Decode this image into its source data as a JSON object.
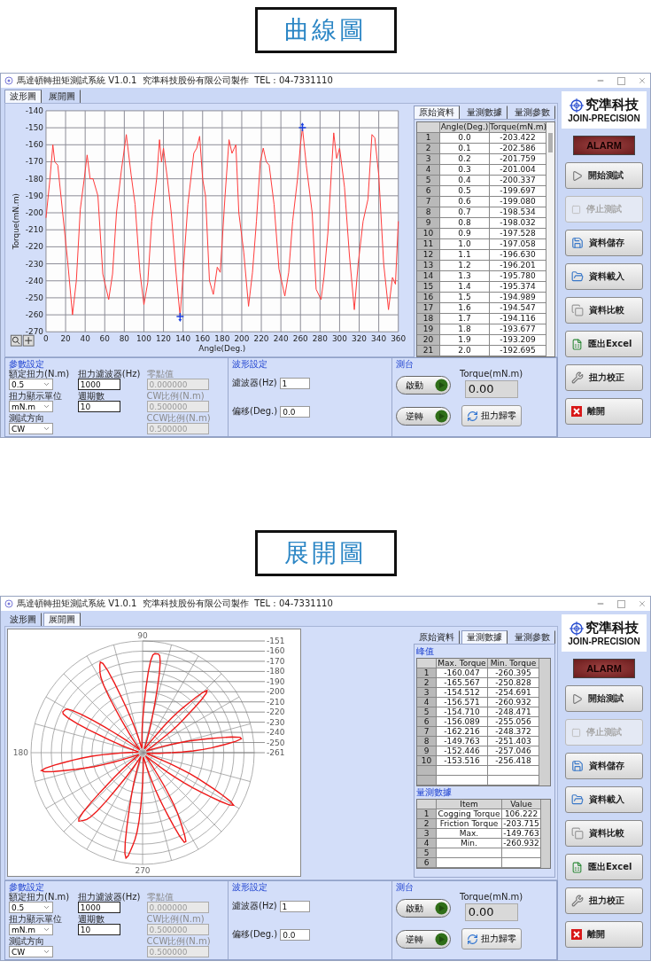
{
  "sections": [
    {
      "heading": "曲線圖",
      "window": {
        "title": "馬達頓轉扭矩測試系統 V1.0.1  究準科技股份有限公司製作  TEL : 04-7331110",
        "view_tabs": [
          {
            "label": "波形圖",
            "selected": true
          },
          {
            "label": "展開圖",
            "selected": false
          }
        ],
        "view": {
          "kind": "line",
          "chart_data": {
            "type": "line",
            "xlabel": "Angle(Deg.)",
            "ylabel": "Torque(mN.m)",
            "xlim": [
              0,
              360
            ],
            "ylim": [
              -270,
              -140
            ],
            "xticks": [
              0,
              20,
              40,
              60,
              80,
              100,
              120,
              140,
              160,
              180,
              200,
              220,
              240,
              260,
              280,
              300,
              320,
              340,
              360
            ],
            "yticks": [
              -140,
              -150,
              -160,
              -170,
              -180,
              -190,
              -200,
              -210,
              -220,
              -230,
              -240,
              -250,
              -260,
              -270
            ],
            "x": [
              0,
              4,
              7,
              9,
              12,
              17,
              22,
              27,
              31,
              35,
              39,
              42,
              45,
              48,
              53,
              58,
              64,
              68,
              72,
              77,
              82,
              87,
              91,
              96,
              100,
              104,
              108,
              113,
              116,
              118,
              120,
              124,
              128,
              133,
              137,
              141,
              145,
              151,
              154,
              157,
              160,
              163,
              167,
              171,
              175,
              178,
              183,
              187,
              190,
              194,
              197,
              202,
              207,
              211,
              215,
              219,
              222,
              225,
              228,
              233,
              238,
              244,
              248,
              252,
              257,
              260,
              262,
              266,
              272,
              276,
              281,
              284,
              288,
              292,
              294,
              297,
              300,
              305,
              310,
              315,
              319,
              324,
              329,
              333,
              336,
              340,
              345,
              350,
              354,
              357,
              360
            ],
            "values": [
              -203,
              -180,
              -160,
              -170,
              -172,
              -200,
              -228,
              -260,
              -240,
              -198,
              -180,
              -166,
              -180,
              -180,
              -190,
              -236,
              -251,
              -236,
              -200,
              -175,
              -154,
              -178,
              -195,
              -235,
              -254,
              -241,
              -205,
              -180,
              -157,
              -170,
              -162,
              -180,
              -200,
              -236,
              -261,
              -228,
              -195,
              -165,
              -162,
              -155,
              -180,
              -190,
              -240,
              -248,
              -232,
              -235,
              -190,
              -157,
              -165,
              -160,
              -200,
              -223,
              -255,
              -235,
              -205,
              -170,
              -162,
              -170,
              -172,
              -195,
              -233,
              -249,
              -235,
              -205,
              -180,
              -160,
              -150,
              -172,
              -200,
              -245,
              -251,
              -238,
              -212,
              -172,
              -153,
              -168,
              -162,
              -185,
              -225,
              -257,
              -230,
              -205,
              -192,
              -154,
              -156,
              -178,
              -230,
              -257,
              -238,
              -242,
              -205
            ],
            "grid": true
          },
          "cursors": true
        },
        "side": {
          "tabs": [
            {
              "label": "原始資料",
              "selected": true
            },
            {
              "label": "量測數據",
              "selected": false
            },
            {
              "label": "量測參數",
              "selected": false
            }
          ],
          "kind": "raw",
          "columns": [
            "",
            "Angle(Deg.)",
            "Torque(mN.m)"
          ],
          "rows": [
            [
              "1",
              "0.0",
              "-203.422"
            ],
            [
              "2",
              "0.1",
              "-202.586"
            ],
            [
              "3",
              "0.2",
              "-201.759"
            ],
            [
              "4",
              "0.3",
              "-201.004"
            ],
            [
              "5",
              "0.4",
              "-200.337"
            ],
            [
              "6",
              "0.5",
              "-199.697"
            ],
            [
              "7",
              "0.6",
              "-199.080"
            ],
            [
              "8",
              "0.7",
              "-198.534"
            ],
            [
              "9",
              "0.8",
              "-198.032"
            ],
            [
              "10",
              "0.9",
              "-197.528"
            ],
            [
              "11",
              "1.0",
              "-197.058"
            ],
            [
              "12",
              "1.1",
              "-196.630"
            ],
            [
              "13",
              "1.2",
              "-196.201"
            ],
            [
              "14",
              "1.3",
              "-195.780"
            ],
            [
              "15",
              "1.4",
              "-195.374"
            ],
            [
              "16",
              "1.5",
              "-194.989"
            ],
            [
              "17",
              "1.6",
              "-194.547"
            ],
            [
              "18",
              "1.7",
              "-194.116"
            ],
            [
              "19",
              "1.8",
              "-193.677"
            ],
            [
              "20",
              "1.9",
              "-193.209"
            ],
            [
              "21",
              "2.0",
              "-192.695"
            ]
          ]
        },
        "logo": {
          "name": "究準科技",
          "sub": "JOIN-PRECISION"
        },
        "alarm": {
          "label": "ALARM",
          "on": false
        },
        "buttons": [
          {
            "label": "開始測試",
            "disabled": false
          },
          {
            "label": "停止測試",
            "disabled": true
          },
          {
            "label": "資料儲存",
            "disabled": false
          },
          {
            "label": "資料載入",
            "disabled": false
          },
          {
            "label": "資料比較",
            "disabled": false
          },
          {
            "label": "匯出Excel",
            "disabled": false
          },
          {
            "label": "扭力校正",
            "disabled": false
          },
          {
            "label": "離開",
            "disabled": false
          }
        ],
        "params": {
          "title": "參數設定",
          "columns": [
            [
              {
                "label": "額定扭力(N.m)",
                "value": "0.5",
                "kind": "select"
              },
              {
                "label": "扭力顯示單位",
                "value": "mN.m",
                "kind": "select"
              },
              {
                "label": "測試方向",
                "value": "CW",
                "kind": "select"
              }
            ],
            [
              {
                "label": "扭力濾波器(Hz)",
                "value": "1000",
                "kind": "input"
              },
              {
                "label": "週期數",
                "value": "10",
                "kind": "input"
              }
            ],
            [
              {
                "label": "零點值",
                "value": "0.000000",
                "kind": "input",
                "disabled": true
              },
              {
                "label": "CW比例(N.m)",
                "value": "0.500000",
                "kind": "input",
                "disabled": true
              },
              {
                "label": "CCW比例(N.m)",
                "value": "0.500000",
                "kind": "input",
                "disabled": true
              }
            ]
          ]
        },
        "waveform": {
          "title": "波形設定",
          "fields": [
            {
              "label": "濾波器(Hz)",
              "value": "1"
            },
            {
              "label": "偏移(Deg.)",
              "value": "0.0"
            }
          ]
        },
        "stage": {
          "title": "測台",
          "buttons": [
            "啟動",
            "逆轉"
          ],
          "readout_label": "Torque(mN.m)",
          "readout": "0.00",
          "zero_button": "扭力歸零"
        }
      }
    },
    {
      "heading": "展開圖",
      "window": {
        "title": "馬達頓轉扭矩測試系統 V1.0.1  究準科技股份有限公司製作  TEL : 04-7331110",
        "view_tabs": [
          {
            "label": "波形圖",
            "selected": false
          },
          {
            "label": "展開圖",
            "selected": true
          }
        ],
        "view": {
          "kind": "polar",
          "angle_labels": [
            "90",
            "180",
            "270"
          ],
          "radius_labels": [
            "-151",
            "-160",
            "-170",
            "-180",
            "-190",
            "-200",
            "-210",
            "-220",
            "-230",
            "-240",
            "-250",
            "-261"
          ]
        },
        "side": {
          "tabs": [
            {
              "label": "原始資料",
              "selected": false
            },
            {
              "label": "量測數據",
              "selected": true
            },
            {
              "label": "量測參數",
              "selected": false
            }
          ],
          "kind": "measure",
          "tables": [
            {
              "title": "峰值",
              "columns": [
                "",
                "Max. Torque",
                "Min. Torque"
              ],
              "rows": [
                [
                  "1",
                  "-160.047",
                  "-260.395"
                ],
                [
                  "2",
                  "-165.567",
                  "-250.828"
                ],
                [
                  "3",
                  "-154.512",
                  "-254.691"
                ],
                [
                  "4",
                  "-156.571",
                  "-260.932"
                ],
                [
                  "5",
                  "-154.710",
                  "-248.471"
                ],
                [
                  "6",
                  "-156.089",
                  "-255.056"
                ],
                [
                  "7",
                  "-162.216",
                  "-248.372"
                ],
                [
                  "8",
                  "-149.763",
                  "-251.403"
                ],
                [
                  "9",
                  "-152.446",
                  "-257.046"
                ],
                [
                  "10",
                  "-153.516",
                  "-256.418"
                ]
              ]
            },
            {
              "title": "量測數據",
              "columns": [
                "",
                "Item",
                "Value"
              ],
              "rows": [
                [
                  "1",
                  "Cogging Torque",
                  "106.222"
                ],
                [
                  "2",
                  "Friction Torque",
                  "-203.715"
                ],
                [
                  "3",
                  "Max.",
                  "-149.763"
                ],
                [
                  "4",
                  "Min.",
                  "-260.932"
                ],
                [
                  "5"
                ],
                [
                  "6"
                ]
              ]
            }
          ]
        },
        "logo": {
          "name": "究準科技",
          "sub": "JOIN-PRECISION"
        },
        "alarm": {
          "label": "ALARM",
          "on": false
        },
        "buttons": [
          {
            "label": "開始測試",
            "disabled": false
          },
          {
            "label": "停止測試",
            "disabled": true
          },
          {
            "label": "資料儲存",
            "disabled": false
          },
          {
            "label": "資料載入",
            "disabled": false
          },
          {
            "label": "資料比較",
            "disabled": false
          },
          {
            "label": "匯出Excel",
            "disabled": false
          },
          {
            "label": "扭力校正",
            "disabled": false
          },
          {
            "label": "離開",
            "disabled": false
          }
        ],
        "params": {
          "title": "參數設定",
          "columns": [
            [
              {
                "label": "額定扭力(N.m)",
                "value": "0.5",
                "kind": "select"
              },
              {
                "label": "扭力顯示單位",
                "value": "mN.m",
                "kind": "select"
              },
              {
                "label": "測試方向",
                "value": "CW",
                "kind": "select"
              }
            ],
            [
              {
                "label": "扭力濾波器(Hz)",
                "value": "1000",
                "kind": "input"
              },
              {
                "label": "週期數",
                "value": "10",
                "kind": "input"
              }
            ],
            [
              {
                "label": "零點值",
                "value": "0.000000",
                "kind": "input",
                "disabled": true
              },
              {
                "label": "CW比例(N.m)",
                "value": "0.500000",
                "kind": "input",
                "disabled": true
              },
              {
                "label": "CCW比例(N.m)",
                "value": "0.500000",
                "kind": "input",
                "disabled": true
              }
            ]
          ]
        },
        "waveform": {
          "title": "波形設定",
          "fields": [
            {
              "label": "濾波器(Hz)",
              "value": "1"
            },
            {
              "label": "偏移(Deg.)",
              "value": "0.0"
            }
          ]
        },
        "stage": {
          "title": "測台",
          "buttons": [
            "啟動",
            "逆轉"
          ],
          "readout_label": "Torque(mN.m)",
          "readout": "0.00",
          "zero_button": "扭力歸零"
        }
      }
    }
  ]
}
